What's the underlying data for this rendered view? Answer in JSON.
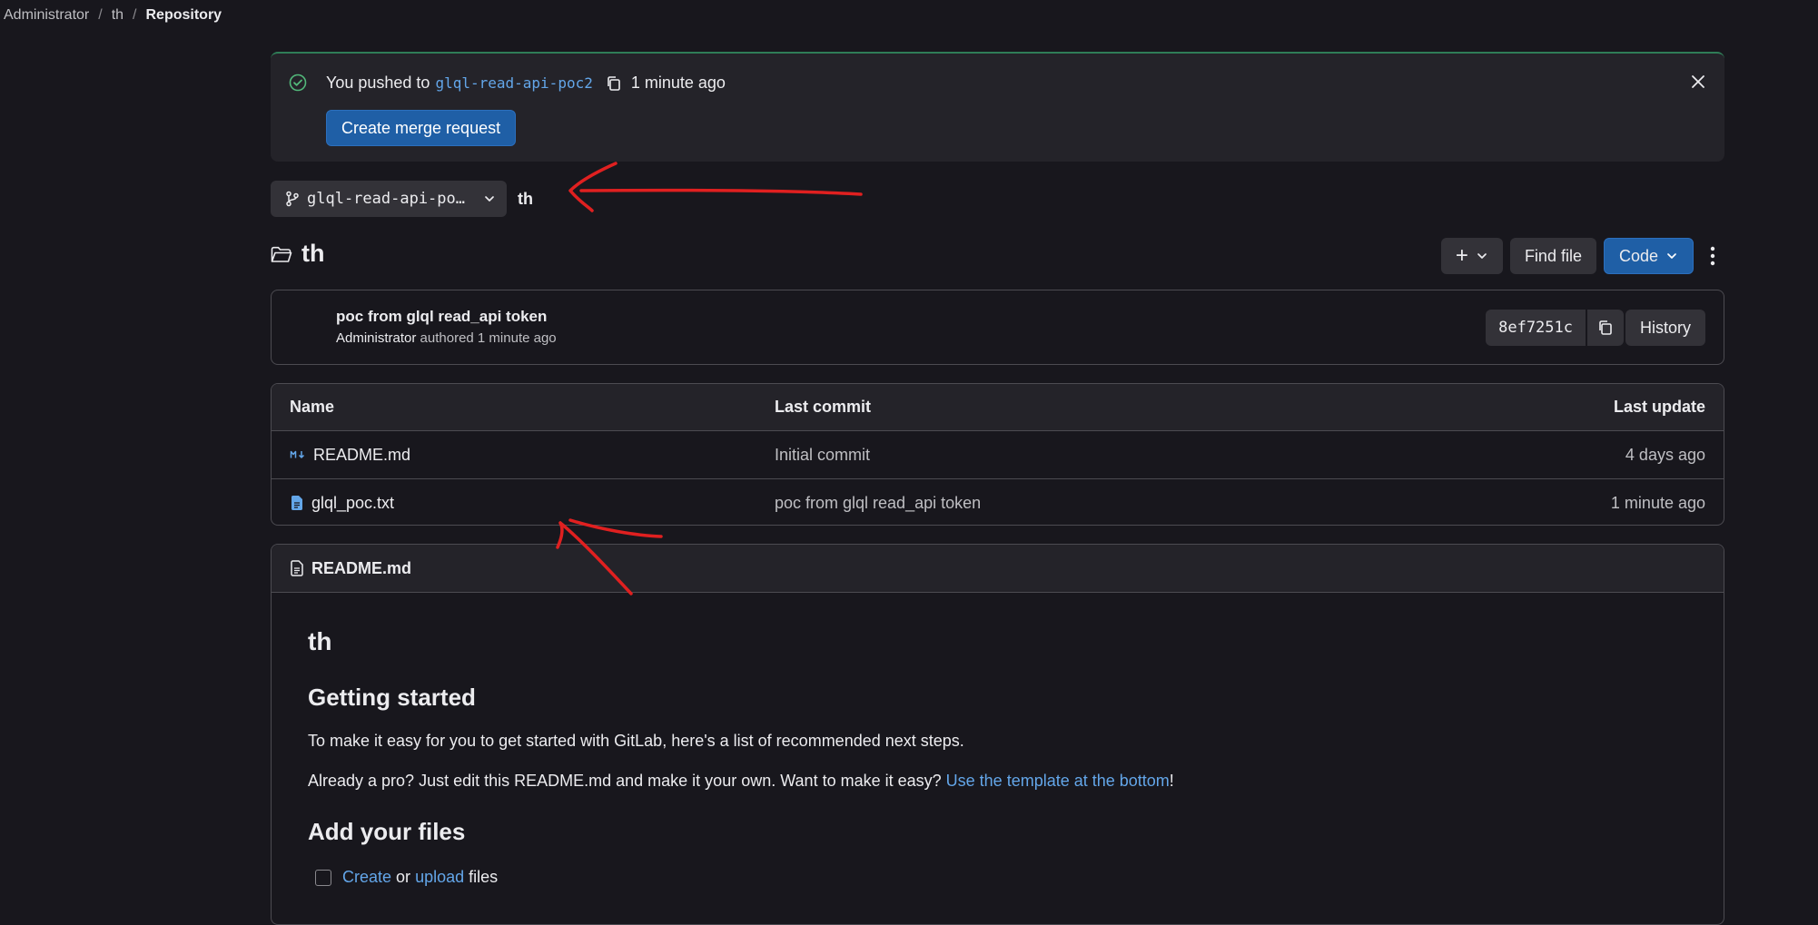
{
  "breadcrumb": {
    "items": [
      "Administrator",
      "th"
    ],
    "current": "Repository",
    "separator": "/"
  },
  "alert": {
    "prefix": "You pushed to",
    "branch": "glql-read-api-poc2",
    "time": "1 minute ago",
    "button": "Create merge request"
  },
  "branch_selector": {
    "label": "glql-read-api-po…",
    "path": "th"
  },
  "project": {
    "title": "th",
    "actions": {
      "add": "+",
      "find_file": "Find file",
      "code": "Code"
    }
  },
  "last_commit": {
    "message": "poc from glql read_api token",
    "author": "Administrator",
    "authored_text": "authored",
    "time": "1 minute ago",
    "sha": "8ef7251c",
    "history": "History"
  },
  "files": {
    "columns": [
      "Name",
      "Last commit",
      "Last update"
    ],
    "rows": [
      {
        "icon": "markdown-icon",
        "name": "README.md",
        "commit": "Initial commit",
        "updated": "4 days ago"
      },
      {
        "icon": "text-file-icon",
        "name": "glql_poc.txt",
        "commit": "poc from glql read_api token",
        "updated": "1 minute ago"
      }
    ]
  },
  "readme": {
    "filename": "README.md",
    "h1": "th",
    "h2_getting_started": "Getting started",
    "p1": "To make it easy for you to get started with GitLab, here's a list of recommended next steps.",
    "p2_before": "Already a pro? Just edit this README.md and make it your own. Want to make it easy?",
    "p2_link": "Use the template at the bottom",
    "p2_after": "!",
    "h2_add_files": "Add your files",
    "task_link1": "Create",
    "task_mid": "or",
    "task_link2": "upload",
    "task_after": "files"
  },
  "colors": {
    "background": "#18171d",
    "surface": "#242329",
    "button": "#333238",
    "primary": "#1f5fa6",
    "link": "#63a6e9",
    "success": "#52b87a",
    "annotation": "#e02020"
  }
}
